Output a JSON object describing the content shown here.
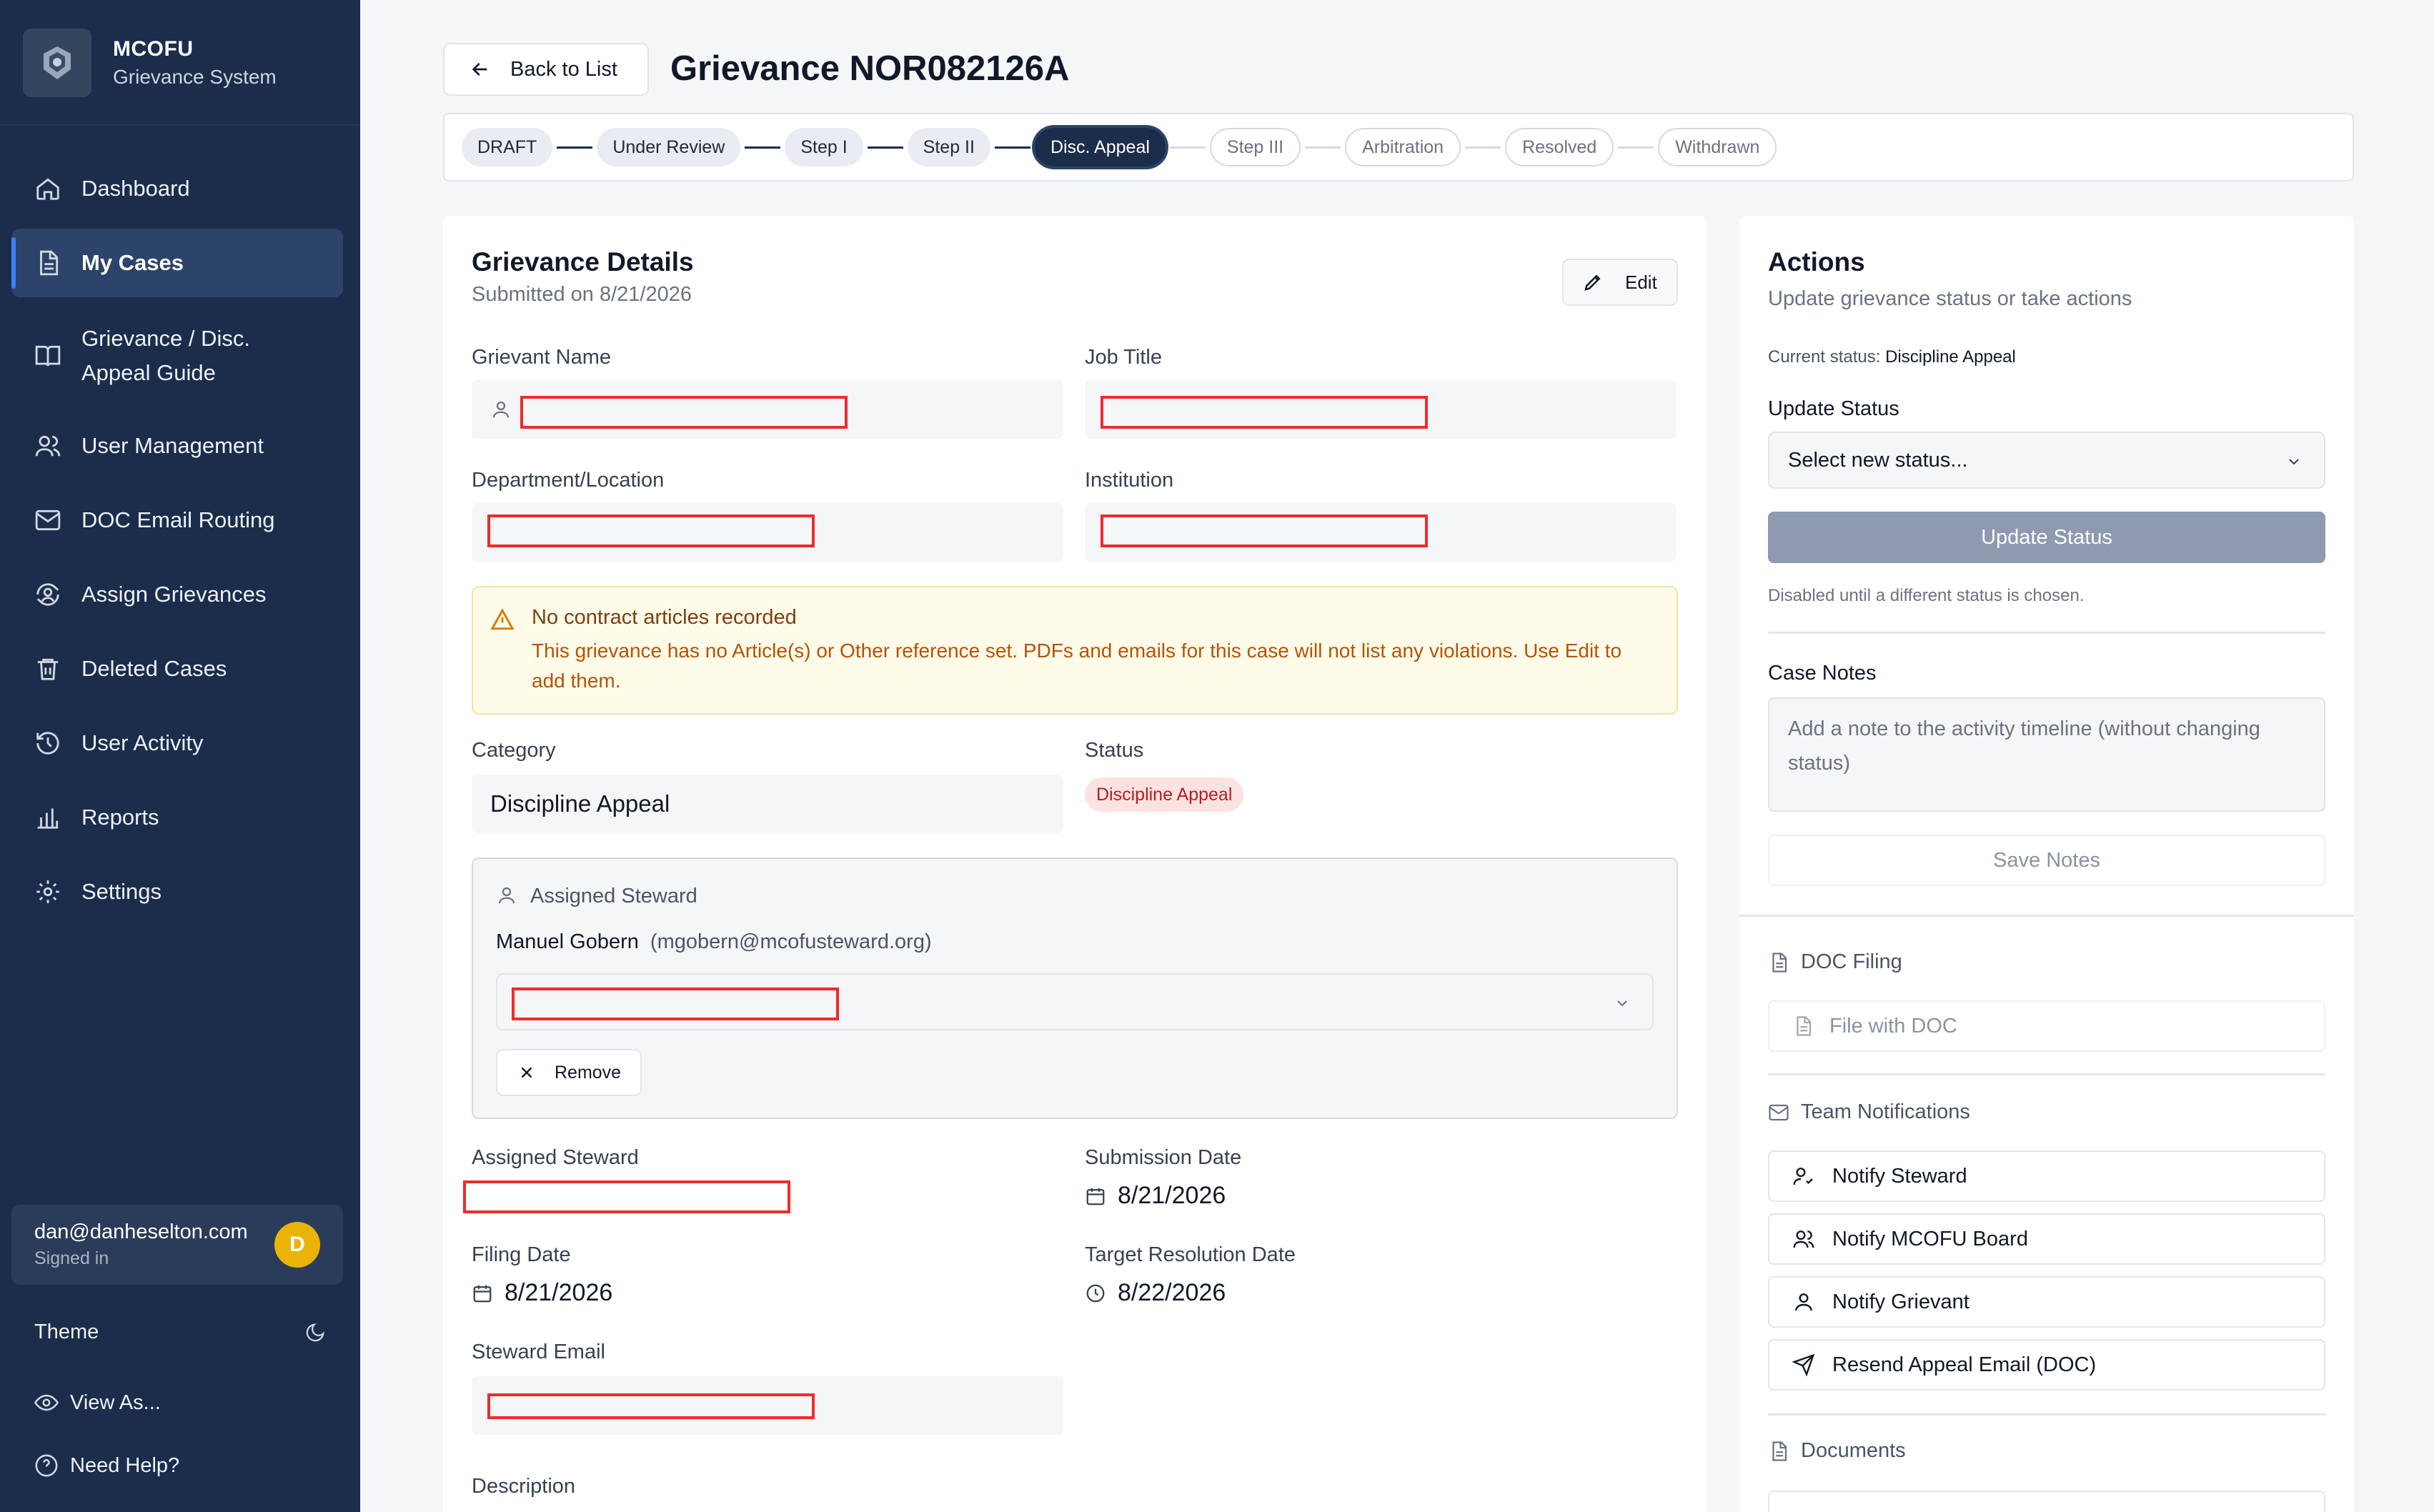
{
  "brand": {
    "title": "MCOFU",
    "subtitle": "Grievance System"
  },
  "sidebar": {
    "items": [
      {
        "label": "Dashboard",
        "icon": "home-icon"
      },
      {
        "label": "My Cases",
        "icon": "file-icon",
        "active": true
      },
      {
        "label_line1": "Grievance / Disc.",
        "label_line2": "Appeal Guide",
        "icon": "book-icon"
      },
      {
        "label": "User Management",
        "icon": "users-icon"
      },
      {
        "label": "DOC Email Routing",
        "icon": "mail-icon"
      },
      {
        "label": "Assign Grievances",
        "icon": "user-cycle-icon"
      },
      {
        "label": "Deleted Cases",
        "icon": "trash-icon"
      },
      {
        "label": "User Activity",
        "icon": "history-icon"
      },
      {
        "label": "Reports",
        "icon": "bar-chart-icon"
      },
      {
        "label": "Settings",
        "icon": "gear-icon"
      }
    ],
    "user": {
      "email": "dan@danheselton.com",
      "status": "Signed in",
      "initial": "D"
    },
    "theme_label": "Theme",
    "view_as_label": "View As...",
    "help_label": "Need Help?"
  },
  "header": {
    "back_label": "Back to List",
    "title": "Grievance NOR082126A"
  },
  "stepper": {
    "steps": [
      {
        "label": "DRAFT",
        "state": "done"
      },
      {
        "label": "Under Review",
        "state": "done"
      },
      {
        "label": "Step I",
        "state": "done"
      },
      {
        "label": "Step II",
        "state": "done"
      },
      {
        "label": "Disc. Appeal",
        "state": "current"
      },
      {
        "label": "Step III",
        "state": "future"
      },
      {
        "label": "Arbitration",
        "state": "future"
      },
      {
        "label": "Resolved",
        "state": "future"
      },
      {
        "label": "Withdrawn",
        "state": "future"
      }
    ]
  },
  "details": {
    "title": "Grievance Details",
    "submitted": "Submitted on 8/21/2026",
    "edit_label": "Edit",
    "grievant_name_label": "Grievant Name",
    "job_title_label": "Job Title",
    "department_label": "Department/Location",
    "institution_label": "Institution",
    "warning": {
      "title": "No contract articles recorded",
      "text": "This grievance has no Article(s) or Other reference set. PDFs and emails for this case will not list any violations. Use Edit to add them."
    },
    "category_label": "Category",
    "category_value": "Discipline Appeal",
    "status_label": "Status",
    "status_value": "Discipline Appeal",
    "steward_box": {
      "label": "Assigned Steward",
      "name": "Manuel Gobern",
      "email": "(mgobern@mcofusteward.org)",
      "remove_label": "Remove"
    },
    "assigned_steward_label": "Assigned Steward",
    "submission_date_label": "Submission Date",
    "submission_date": "8/21/2026",
    "filing_date_label": "Filing Date",
    "filing_date": "8/21/2026",
    "target_date_label": "Target Resolution Date",
    "target_date": "8/22/2026",
    "steward_email_label": "Steward Email",
    "description_label": "Description"
  },
  "actions": {
    "title": "Actions",
    "subtitle": "Update grievance status or take actions",
    "current_status_prefix": "Current status:",
    "current_status": "Discipline Appeal",
    "update_status_label": "Update Status",
    "select_placeholder": "Select new status...",
    "update_button": "Update Status",
    "disabled_hint": "Disabled until a different status is chosen.",
    "case_notes_label": "Case Notes",
    "notes_placeholder": "Add a note to the activity timeline (without changing status)",
    "save_notes": "Save Notes",
    "doc_filing_label": "DOC Filing",
    "file_with_doc": "File with DOC",
    "team_notifications_label": "Team Notifications",
    "notify_steward": "Notify Steward",
    "notify_board": "Notify MCOFU Board",
    "notify_grievant": "Notify Grievant",
    "resend_appeal": "Resend Appeal Email (DOC)",
    "documents_label": "Documents"
  },
  "colors": {
    "sidebar_bg": "#1b2d4b",
    "accent": "#3b82f6",
    "status_badge_bg": "#fde2e2",
    "status_badge_text": "#b91c1c",
    "warning_bg": "#fefbe8",
    "redaction": "#ef2b2b"
  }
}
